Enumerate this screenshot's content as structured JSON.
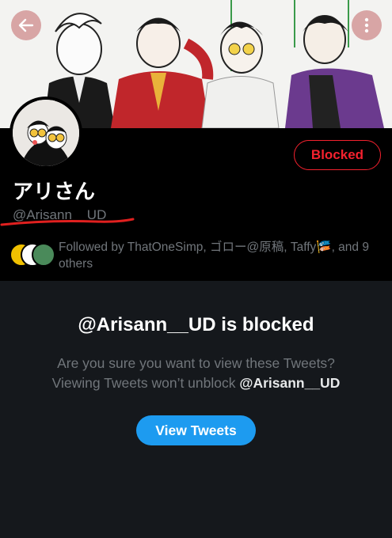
{
  "header": {
    "back_icon": "arrow-left-icon",
    "more_icon": "more-vertical-icon",
    "accent_color": "#d6a0a0"
  },
  "profile": {
    "display_name": "アリさん",
    "handle": "@Arisann__UD",
    "block_status_label": "Blocked",
    "followed_by_text": "Followed by ThatOneSimp, ゴロー@原稿, Taffy🎏, and 9 others"
  },
  "blocked_notice": {
    "title": "@Arisann__UD is blocked",
    "line1": "Are you sure you want to view these Tweets?",
    "line2_prefix": "Viewing Tweets won’t unblock ",
    "line2_handle": "@Arisann__UD",
    "view_button_label": "View Tweets"
  },
  "colors": {
    "blocked_red": "#f4212e",
    "link_blue": "#1d9bf0",
    "secondary_text": "#71767b"
  }
}
